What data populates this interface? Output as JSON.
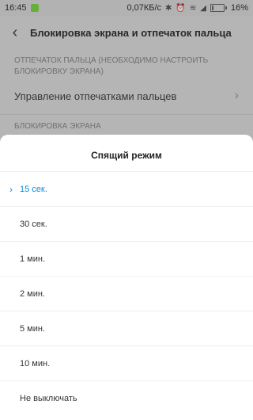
{
  "status_bar": {
    "time": "16:45",
    "network_speed": "0,07КБ/с",
    "battery": "16%",
    "battery_level": 0.16
  },
  "app_bar": {
    "title": "Блокировка экрана и отпечаток пальца"
  },
  "background": {
    "section_fingerprint": "ОТПЕЧАТОК ПАЛЬЦА (НЕОБХОДИМО НАСТРОИТЬ БЛОКИРОВКУ ЭКРАНА)",
    "fingerprint_item": "Управление отпечатками пальцев",
    "section_lock": "БЛОКИРОВКА ЭКРАНА"
  },
  "dialog": {
    "title": "Спящий режим",
    "options": [
      {
        "label": "15 сек.",
        "selected": true
      },
      {
        "label": "30 сек.",
        "selected": false
      },
      {
        "label": "1 мин.",
        "selected": false
      },
      {
        "label": "2 мин.",
        "selected": false
      },
      {
        "label": "5 мин.",
        "selected": false
      },
      {
        "label": "10 мин.",
        "selected": false
      },
      {
        "label": "Не выключать",
        "selected": false
      }
    ],
    "accent_color": "#0a8de0"
  },
  "icons": {
    "back": "back-icon",
    "chevron": "chevron-right-icon",
    "check": "check-icon"
  }
}
